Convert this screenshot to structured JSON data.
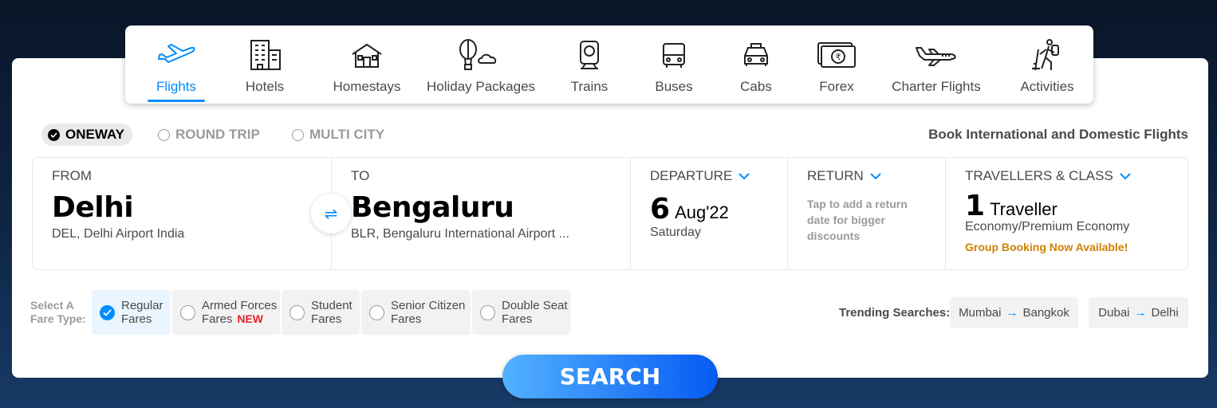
{
  "nav": {
    "items": [
      {
        "label": "Flights",
        "icon": "plane-icon"
      },
      {
        "label": "Hotels",
        "icon": "hotel-icon"
      },
      {
        "label": "Homestays",
        "icon": "home-icon"
      },
      {
        "label": "Holiday Packages",
        "icon": "balloon-cloud-icon"
      },
      {
        "label": "Trains",
        "icon": "train-icon"
      },
      {
        "label": "Buses",
        "icon": "bus-icon"
      },
      {
        "label": "Cabs",
        "icon": "cab-icon"
      },
      {
        "label": "Forex",
        "icon": "rupee-note-icon"
      },
      {
        "label": "Charter Flights",
        "icon": "private-jet-icon"
      },
      {
        "label": "Activities",
        "icon": "hiker-icon"
      }
    ],
    "active": "Flights"
  },
  "trip_types": {
    "oneway": "ONEWAY",
    "round_trip": "ROUND TRIP",
    "multi_city": "MULTI CITY",
    "selected": "ONEWAY"
  },
  "tagline": "Book International and Domestic Flights",
  "search": {
    "from": {
      "label": "FROM",
      "city": "Delhi",
      "detail": "DEL, Delhi Airport India"
    },
    "to": {
      "label": "TO",
      "city": "Bengaluru",
      "detail": "BLR, Bengaluru International Airport ..."
    },
    "departure": {
      "label": "DEPARTURE",
      "day": "6",
      "month_year": "Aug'22",
      "weekday": "Saturday"
    },
    "return": {
      "label": "RETURN",
      "hint": "Tap to add a return date for bigger discounts"
    },
    "travellers": {
      "label": "TRAVELLERS & CLASS",
      "count": "1",
      "unit": "Traveller",
      "class": "Economy/Premium Economy",
      "group_link": "Group Booking Now Available!"
    }
  },
  "fares": {
    "label_line1": "Select A",
    "label_line2": "Fare Type:",
    "options": [
      {
        "line1": "Regular",
        "line2": "Fares"
      },
      {
        "line1": "Armed Forces",
        "line2": "Fares"
      },
      {
        "line1": "Student",
        "line2": "Fares"
      },
      {
        "line1": "Senior Citizen",
        "line2": "Fares"
      },
      {
        "line1": "Double Seat",
        "line2": "Fares"
      }
    ],
    "new_badge": "NEW",
    "selected": "Regular"
  },
  "trending": {
    "label": "Trending Searches:",
    "items": [
      {
        "from": "Mumbai",
        "to": "Bangkok"
      },
      {
        "from": "Dubai",
        "to": "Delhi"
      }
    ]
  },
  "search_button": "SEARCH",
  "colors": {
    "accent": "#008cff",
    "orange": "#cf8100",
    "new": "#eb2026"
  }
}
